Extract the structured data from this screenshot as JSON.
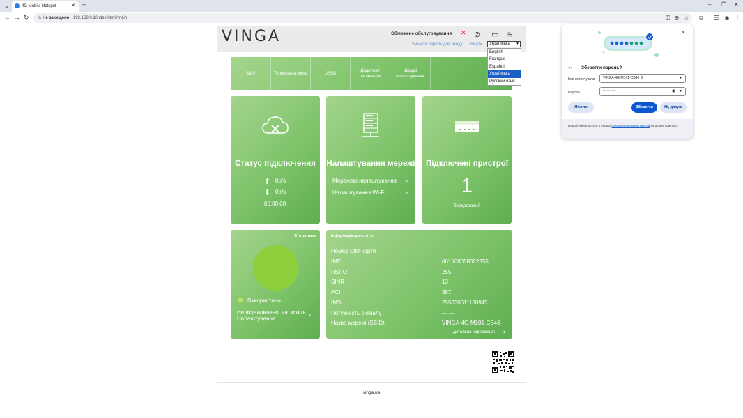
{
  "browser": {
    "tab_title": "4G Mobile Hotspot",
    "not_secure_label": "Не захищено",
    "url": "192.168.0.1/index.html#main"
  },
  "header": {
    "logo": "VINGA",
    "limited_service": "Обмежене обслуговування",
    "change_password": "Змінити пароль для входу",
    "logout": "Вийти",
    "language_selected": "Українська",
    "languages": [
      "English",
      "Français",
      "Español",
      "Українська",
      "Русский язык"
    ]
  },
  "nav": {
    "items": [
      {
        "label": "SMS"
      },
      {
        "label": "Телефонна книга"
      },
      {
        "label": "USSD"
      },
      {
        "label": "Додаткові параметри"
      },
      {
        "label": "Швидкі налаштування"
      }
    ]
  },
  "cards": {
    "connection": {
      "title": "Статус підключення",
      "upload": "0b/s",
      "download": "0b/s",
      "time": "00:00:00"
    },
    "network": {
      "title": "Налаштування мережі",
      "link1": "Мережеві налаштування",
      "link2": "Налаштування Wi-Fi"
    },
    "devices": {
      "title": "Підключені пристрої",
      "count": "1",
      "type": "бездротовий"
    }
  },
  "stats": {
    "title": "Статистика",
    "used_label": "Використано",
    "used_value": ":",
    "not_set": "Не встановлено, натисніть Налаштування"
  },
  "info": {
    "title": "Інформація про статус",
    "rows": [
      {
        "key": "Номер SIM-карти",
        "value": "— —"
      },
      {
        "key": "IMEI",
        "value": "861568058022355"
      },
      {
        "key": "RSRQ",
        "value": "255"
      },
      {
        "key": "SINR",
        "value": "13"
      },
      {
        "key": "PCI",
        "value": "357"
      },
      {
        "key": "IMSI",
        "value": "255030611168945"
      },
      {
        "key": "Потужність сигналу",
        "value": "— —"
      },
      {
        "key": "Назва мережі (SSID)",
        "value": "VINGA-4G-M101-CB46"
      }
    ],
    "detail_link": "Детальна інформація"
  },
  "footer": {
    "text": "vinga.ua"
  },
  "password_popup": {
    "title": "Зберегти пароль?",
    "username_label": "Ім'я користувача",
    "username_value": "VINGA-4G-M101-CB46_2",
    "password_label": "Пароль",
    "password_value": "••••••••••",
    "never_button": "Ніколи",
    "save_button": "Зберегти",
    "no_thanks_button": "Ні, дякую",
    "note_prefix": "Паролі зберігаються в сервісі ",
    "note_link": "Google Менеджер паролів",
    "note_suffix": " на цьому пристрої."
  }
}
